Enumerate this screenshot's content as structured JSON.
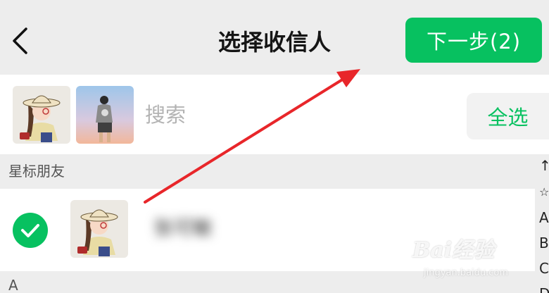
{
  "header": {
    "title": "选择收信人",
    "next_label": "下一步(2)",
    "back_icon": "chevron-left-icon"
  },
  "search": {
    "placeholder": "搜索",
    "select_all_label": "全选",
    "selected_count": 2
  },
  "sections": [
    {
      "label": "星标朋友"
    },
    {
      "label": "A"
    }
  ],
  "contacts": [
    {
      "name": "张可敏",
      "checked": true
    }
  ],
  "index_bar": [
    "↑",
    "☆",
    "A",
    "B",
    "C",
    "D"
  ],
  "watermark": {
    "main": "Bai经验",
    "sub": "jingyan.baidu.com"
  },
  "colors": {
    "accent": "#07c160",
    "arrow": "#e8262a",
    "background": "#ededed"
  }
}
